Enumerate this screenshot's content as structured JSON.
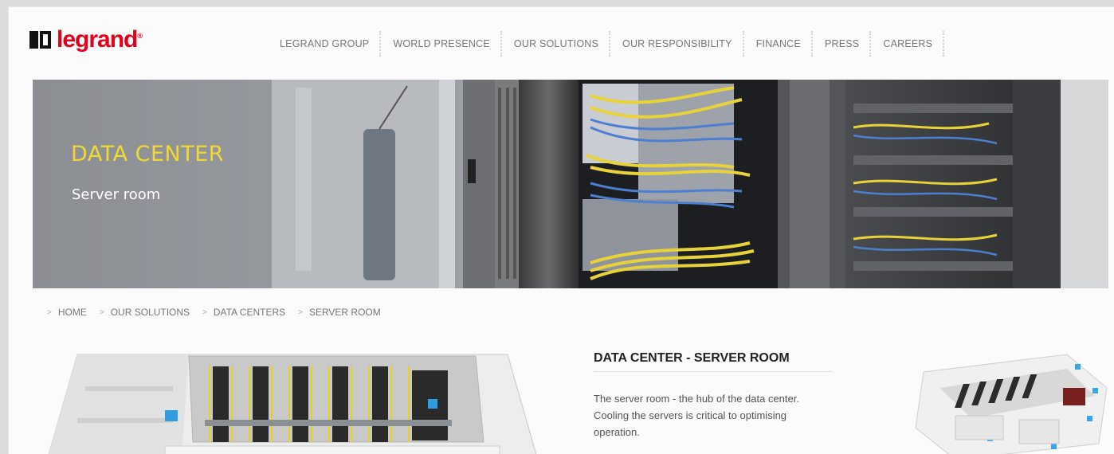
{
  "header": {
    "brand": "legrand",
    "nav": [
      "LEGRAND GROUP",
      "WORLD PRESENCE",
      "OUR SOLUTIONS",
      "OUR RESPONSIBILITY",
      "FINANCE",
      "PRESS",
      "CAREERS"
    ]
  },
  "banner": {
    "title": "DATA CENTER",
    "subtitle": "Server room"
  },
  "breadcrumb": [
    "HOME",
    "OUR SOLUTIONS",
    "DATA CENTERS",
    "SERVER ROOM"
  ],
  "article": {
    "title": "DATA CENTER - SERVER ROOM",
    "body": "The server room - the hub of the data center. Cooling the servers is critical to optimising operation."
  },
  "colors": {
    "brand_red": "#e2001a",
    "banner_title_yellow": "#f2d832",
    "cable_yellow": "#e8d23a",
    "cable_blue": "#4d7fd0"
  }
}
